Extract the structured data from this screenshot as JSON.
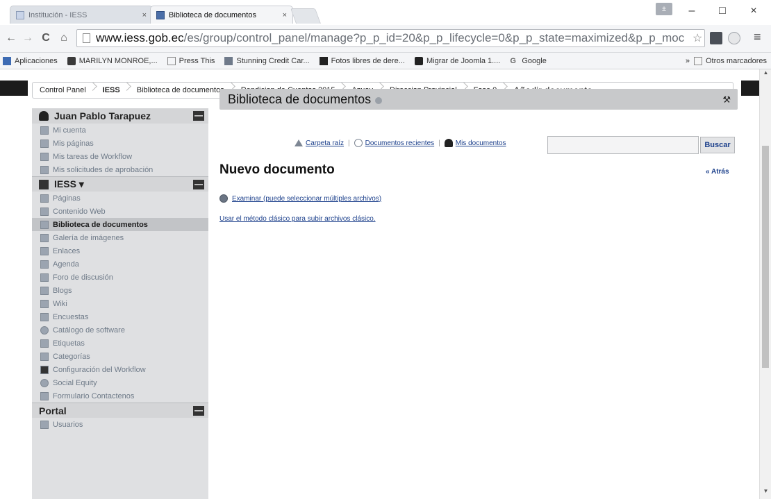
{
  "browser": {
    "tabs": [
      {
        "title": "Institución - IESS",
        "active": false,
        "close": "×"
      },
      {
        "title": "Biblioteca de documentos",
        "active": true,
        "close": "×"
      }
    ],
    "window_buttons": {
      "minimize": "–",
      "maximize": "□",
      "close": "×"
    },
    "user_chip": "±",
    "nav": {
      "back": "←",
      "forward": "→",
      "reload": "C",
      "home": "⌂"
    },
    "url_host": "www.iess.gob.ec",
    "url_path": "/es/group/control_panel/manage?p_p_id=20&p_p_lifecycle=0&p_p_state=maximized&p_p_moc",
    "star": "☆",
    "menu": "≡",
    "bookmarks": [
      "Aplicaciones",
      "MARILYN MONROE,...",
      "Press This",
      "Stunning Credit Car...",
      "Fotos libres de dere...",
      "Migrar de Joomla 1....",
      "Google"
    ],
    "bookmarks_more": "»",
    "other_bookmarks": "Otros marcadores"
  },
  "breadcrumb": [
    "Control Panel",
    "IESS",
    "Biblioteca de documentos",
    "Rendicion de Cuentas 2015",
    "Azuay",
    "Direccion Provincial",
    "Fase 0",
    "Añadir documento"
  ],
  "sidebar": {
    "collapse_symbol": "—",
    "user": {
      "name": "Juan Pablo Tarapuez",
      "items": [
        "Mi cuenta",
        "Mis páginas",
        "Mis tareas de Workflow",
        "Mis solicitudes de aprobación"
      ]
    },
    "site": {
      "name": "IESS ▾",
      "items": [
        "Páginas",
        "Contenido Web",
        "Biblioteca de documentos",
        "Galería de imágenes",
        "Enlaces",
        "Agenda",
        "Foro de discusión",
        "Blogs",
        "Wiki",
        "Encuestas",
        "Catálogo de software",
        "Etiquetas",
        "Categorías",
        "Configuración del Workflow",
        "Social Equity",
        "Formulario Contactenos"
      ],
      "selected_index": 2
    },
    "portal": {
      "name": "Portal",
      "items": [
        "Usuarios"
      ]
    }
  },
  "portlet": {
    "title": "Biblioteca de documentos",
    "wrench": "🔧",
    "nav": {
      "root_folder": "Carpeta raíz",
      "recent_docs": "Documentos recientes",
      "my_docs": "Mis documentos"
    },
    "search_placeholder": "",
    "search_button": "Buscar",
    "heading": "Nuevo documento",
    "back": "« Atrás",
    "browse_link": "Examinar (puede seleccionar múltiples archivos)",
    "classic_link": "Usar el método clásico para subir archivos clásico."
  }
}
